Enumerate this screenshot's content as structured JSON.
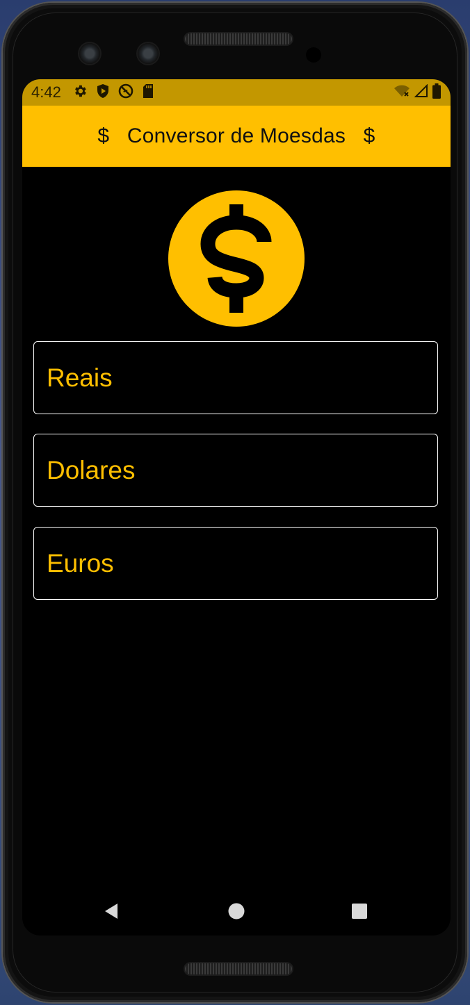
{
  "status_bar": {
    "time": "4:42",
    "left_icons": [
      "gear-icon",
      "shield-icon",
      "do-not-disturb-icon",
      "sd-card-icon"
    ],
    "right_icons": [
      "wifi-icon",
      "signal-icon",
      "battery-icon"
    ]
  },
  "app_bar": {
    "title": "$   Conversor de Moesdas   $",
    "background": "#ffbf00"
  },
  "hero": {
    "icon": "dollar-coin-icon",
    "color": "#ffbf00"
  },
  "fields": [
    {
      "label": "Reais"
    },
    {
      "label": "Dolares"
    },
    {
      "label": "Euros"
    }
  ],
  "nav_bar": {
    "buttons": [
      "back-icon",
      "home-icon",
      "recents-icon"
    ]
  },
  "theme": {
    "accent": "#ffbf00",
    "status_bar": "#c39700",
    "screen_background": "#000000",
    "field_border": "#ffffff"
  }
}
